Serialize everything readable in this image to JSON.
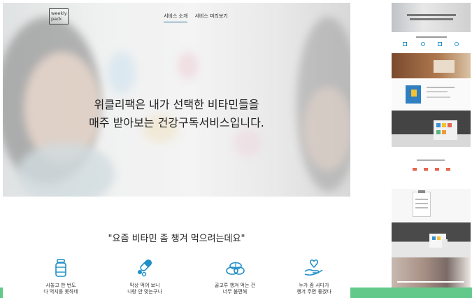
{
  "logo": {
    "line1": "weekly",
    "line2": "pack"
  },
  "nav": {
    "items": [
      {
        "label": "서비스 소개",
        "active": true
      },
      {
        "label": "서비스 미리보기",
        "active": false
      }
    ]
  },
  "hero": {
    "line1": "위클리팩은 내가 선택한 비타민들을",
    "line2": "매주 받아보는 건강구독서비스입니다."
  },
  "section": {
    "quote": "\"요즘 비타민 좀 챙겨 먹으려는데요\"",
    "features": [
      {
        "icon": "pill-bottle-icon",
        "line1": "사놓고 한 번도",
        "line2": "다 먹지를 못하네"
      },
      {
        "icon": "capsule-pills-icon",
        "line1": "막상 먹어 보니",
        "line2": "나랑 안 맞는구나"
      },
      {
        "icon": "pills-pile-icon",
        "line1": "골고루 챙겨 먹는 건",
        "line2": "너무 불편해"
      },
      {
        "icon": "heart-hand-icon",
        "line1": "누가 좀 사다가",
        "line2": "챙겨 주면 좋겠다"
      }
    ]
  },
  "colors": {
    "accent": "#2b6d9c",
    "icon": "#1f8fc7",
    "green": "#63c98a"
  }
}
